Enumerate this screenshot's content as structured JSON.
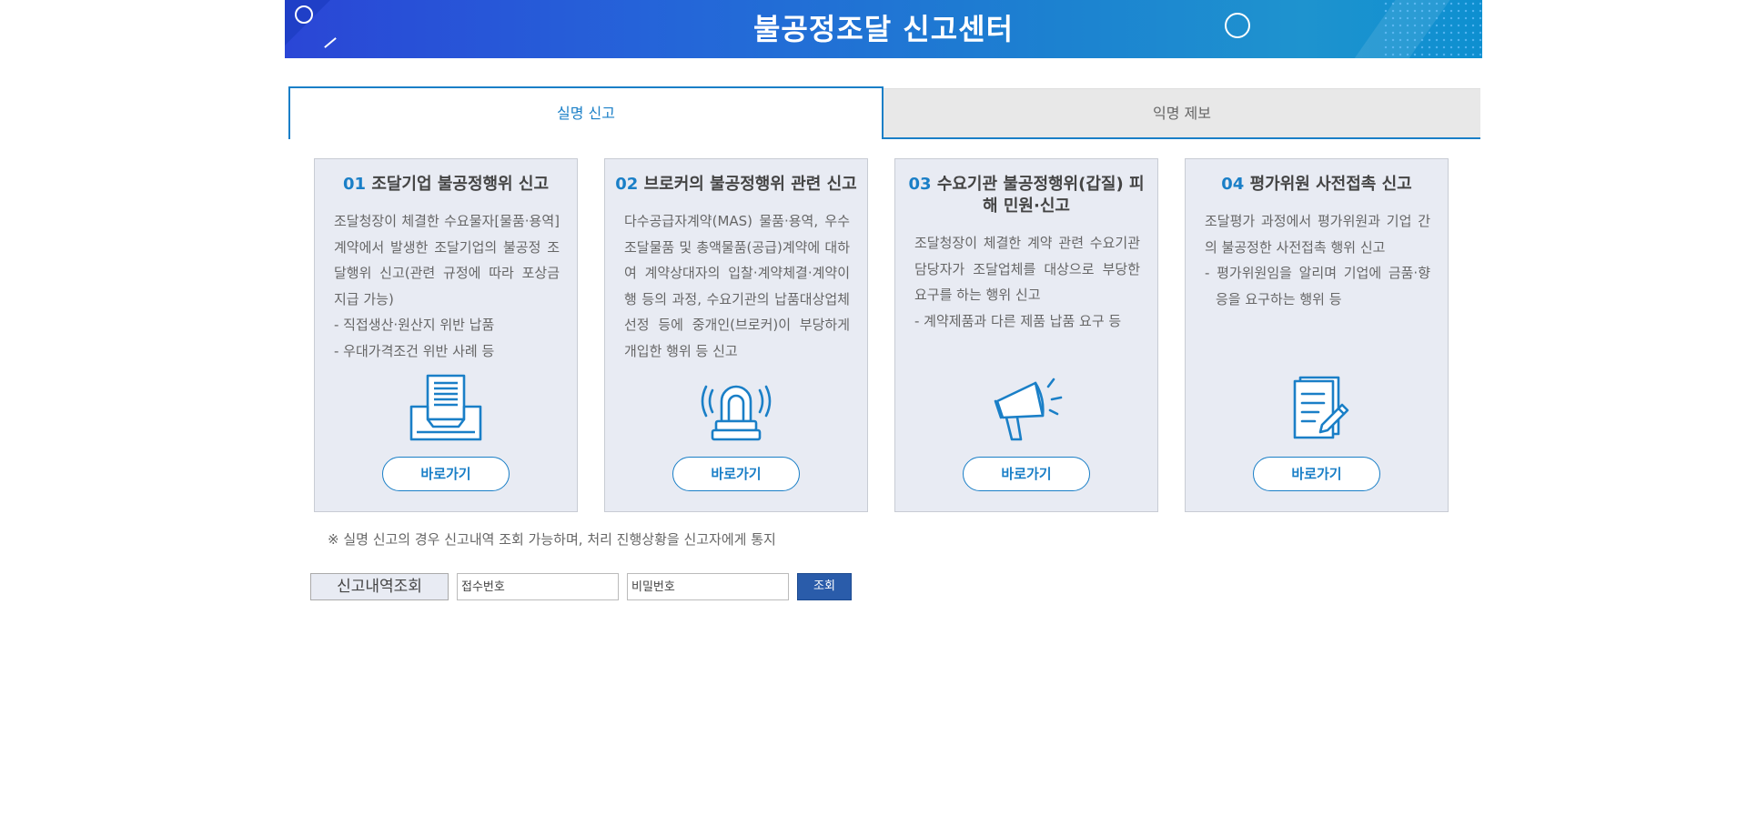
{
  "banner": {
    "title": "불공정조달 신고센터"
  },
  "tabs": [
    {
      "label": "실명 신고",
      "active": true
    },
    {
      "label": "익명 제보",
      "active": false
    }
  ],
  "cards": [
    {
      "num": "01",
      "title": "조달기업 불공정행위 신고",
      "body": "조달청장이 체결한 수요물자[물품·용역] 계약에서 발생한 조달기업의 불공정 조달행위 신고(관련 규정에 따라 포상금 지급 가능)",
      "bullets": [
        "- 직접생산·원산지 위반 납품",
        "- 우대가격조건 위반 사례 등"
      ],
      "icon": "document-tray-icon",
      "button": "바로가기"
    },
    {
      "num": "02",
      "title": "브로커의 불공정행위 관련 신고",
      "body": "다수공급자계약(MAS) 물품·용역, 우수조달물품 및 총액물품(공급)계약에 대하여 계약상대자의 입찰·계약체결·계약이행 등의 과정, 수요기관의 납품대상업체 선정 등에 중개인(브로커)이 부당하게 개입한 행위 등 신고",
      "bullets": [],
      "icon": "siren-icon",
      "button": "바로가기"
    },
    {
      "num": "03",
      "title": "수요기관 불공정행위(갑질) 피해 민원·신고",
      "body": "조달청장이 체결한 계약 관련 수요기관 담당자가 조달업체를 대상으로 부당한 요구를 하는 행위 신고",
      "bullets": [
        "- 계약제품과 다른 제품 납품 요구 등"
      ],
      "icon": "megaphone-icon",
      "button": "바로가기"
    },
    {
      "num": "04",
      "title": "평가위원 사전접촉 신고",
      "body": "조달평가 과정에서 평가위원과 기업 간의 불공정한 사전접촉 행위 신고",
      "bullets": [
        "- 평가위원임을 알리며 기업에 금품·향응을 요구하는 행위 등"
      ],
      "icon": "document-pen-icon",
      "button": "바로가기"
    }
  ],
  "note": "※ 실명 신고의 경우 신고내역 조회 가능하며, 처리 진행상황을 신고자에게 통지",
  "lookup": {
    "label": "신고내역조회",
    "receipt_placeholder": "접수번호",
    "password_placeholder": "비밀번호",
    "button": "조회"
  },
  "colors": {
    "accent": "#1a7fc7",
    "card_bg": "#e8ebf3",
    "button_blue": "#2a5caa"
  }
}
